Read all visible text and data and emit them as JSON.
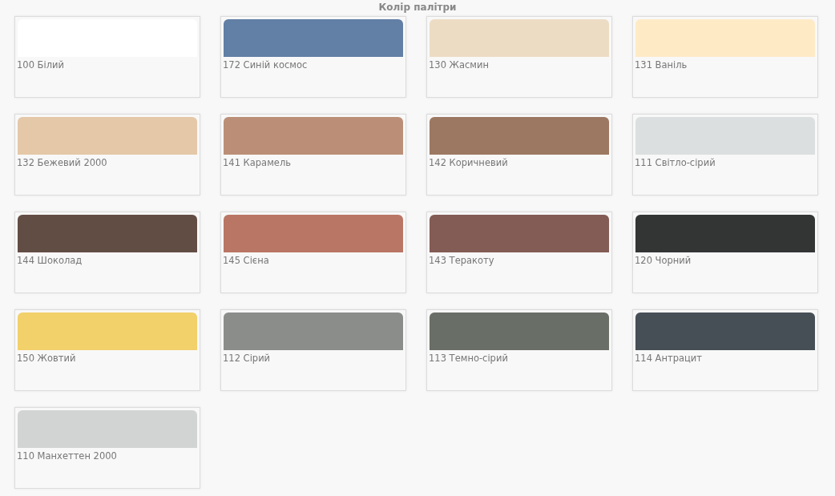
{
  "title": "Колір палітри",
  "swatches": [
    {
      "label": "100 Білий",
      "color": "#ffffff"
    },
    {
      "label": "172 Синій космос",
      "color": "#627fa5"
    },
    {
      "label": "130 Жасмин",
      "color": "#eddcc4"
    },
    {
      "label": "131 Ваніль",
      "color": "#feebc6"
    },
    {
      "label": "132 Бежевий 2000",
      "color": "#e4c8a8"
    },
    {
      "label": "141 Карамель",
      "color": "#bb8f77"
    },
    {
      "label": "142 Коричневий",
      "color": "#9c7862"
    },
    {
      "label": "111 Світло-сірий",
      "color": "#dcdfdf"
    },
    {
      "label": "144 Шоколад",
      "color": "#624d45"
    },
    {
      "label": "145 Сієна",
      "color": "#ba7665"
    },
    {
      "label": "143 Теракоту",
      "color": "#825c55"
    },
    {
      "label": "120 Чорний",
      "color": "#333535"
    },
    {
      "label": "150 Жовтий",
      "color": "#f2d06a"
    },
    {
      "label": "112 Сірий",
      "color": "#8a8d8a"
    },
    {
      "label": "113 Темно-сірий",
      "color": "#696e66"
    },
    {
      "label": "114 Антрацит",
      "color": "#464e56"
    },
    {
      "label": "110 Манхеттен 2000",
      "color": "#d1d4d3"
    }
  ]
}
